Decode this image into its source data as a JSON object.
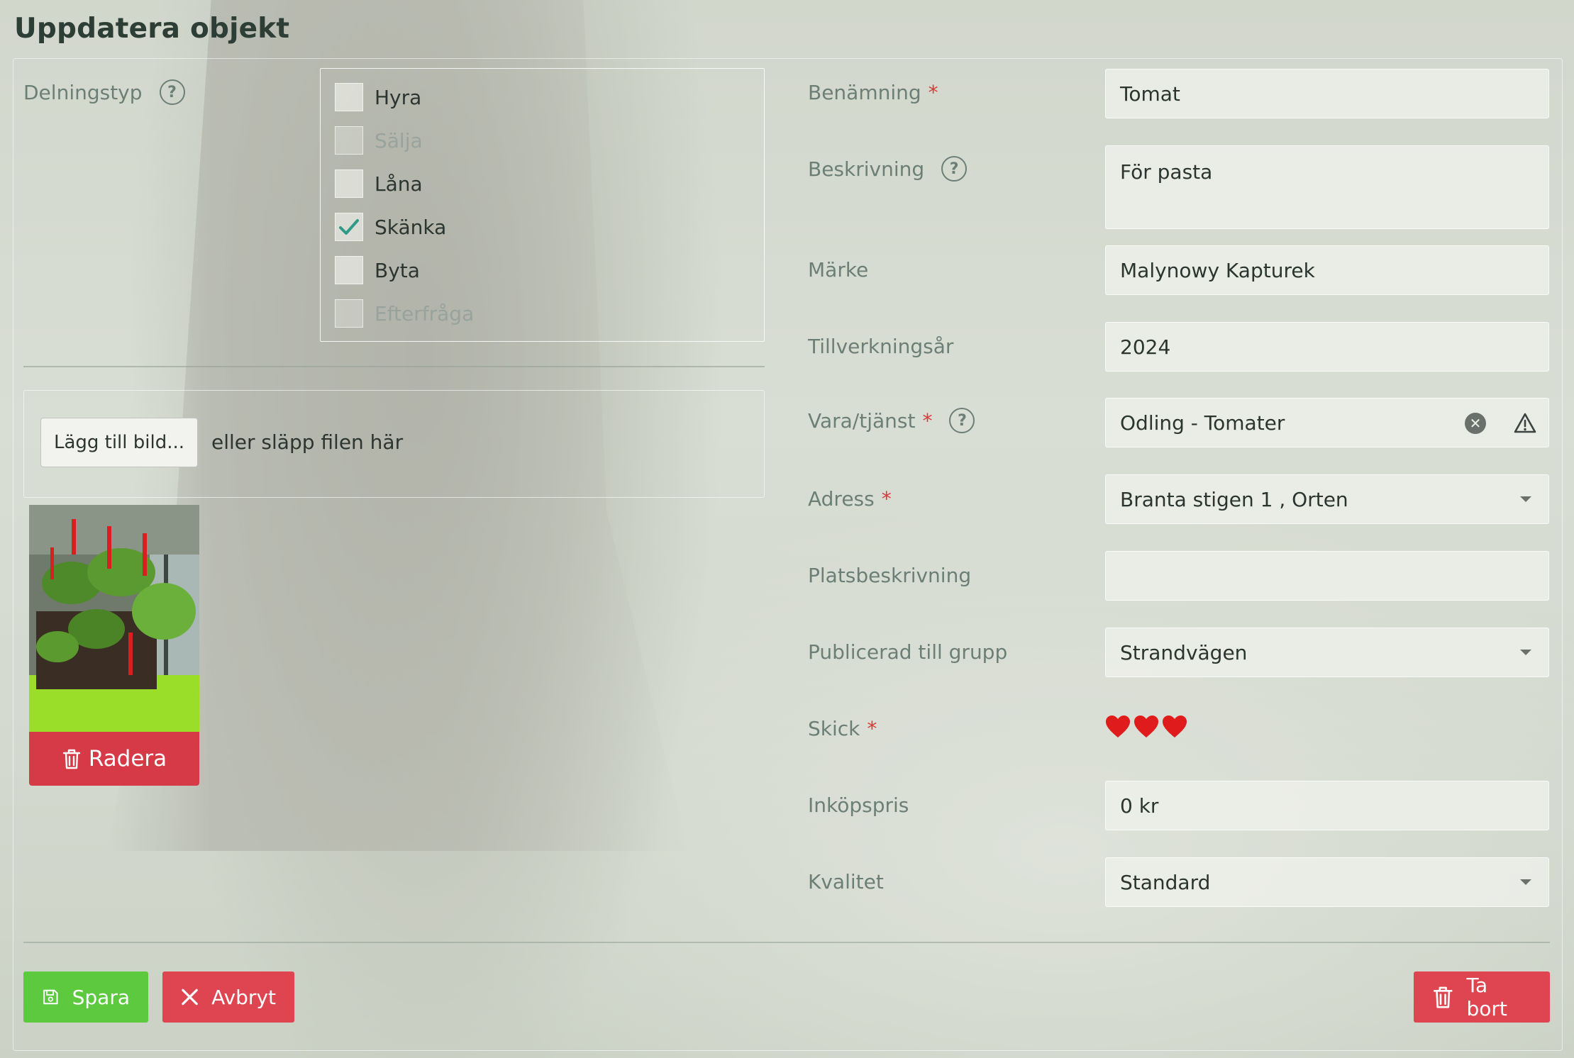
{
  "page_title": "Uppdatera objekt",
  "sharing": {
    "label": "Delningstyp",
    "options": [
      {
        "label": "Hyra",
        "checked": false,
        "disabled": false
      },
      {
        "label": "Sälja",
        "checked": false,
        "disabled": true
      },
      {
        "label": "Låna",
        "checked": false,
        "disabled": false
      },
      {
        "label": "Skänka",
        "checked": true,
        "disabled": false
      },
      {
        "label": "Byta",
        "checked": false,
        "disabled": false
      },
      {
        "label": "Efterfråga",
        "checked": false,
        "disabled": true
      }
    ]
  },
  "upload": {
    "button_label": "Lägg till bild...",
    "hint": "eller släpp filen här",
    "delete_label": "Radera"
  },
  "form": {
    "name_label": "Benämning",
    "name_value": "Tomat",
    "description_label": "Beskrivning",
    "description_value": "För pasta",
    "brand_label": "Märke",
    "brand_value": "Malynowy Kapturek",
    "year_label": "Tillverkningsår",
    "year_value": "2024",
    "product_label": "Vara/tjänst",
    "product_value": "Odling - Tomater",
    "address_label": "Adress",
    "address_value": "Branta stigen 1 , Orten",
    "location_label": "Platsbeskrivning",
    "location_value": "",
    "group_label": "Publicerad till grupp",
    "group_value": "Strandvägen",
    "condition_label": "Skick",
    "condition_rating": 3,
    "price_label": "Inköpspris",
    "price_value": "0 kr",
    "quality_label": "Kvalitet",
    "quality_value": "Standard",
    "required_marker": "*"
  },
  "actions": {
    "save": "Spara",
    "cancel": "Avbryt",
    "delete": "Ta bort"
  },
  "colors": {
    "save": "#5cc93f",
    "danger": "#df4550",
    "required": "#d9383a",
    "heart": "#e01b1b"
  }
}
